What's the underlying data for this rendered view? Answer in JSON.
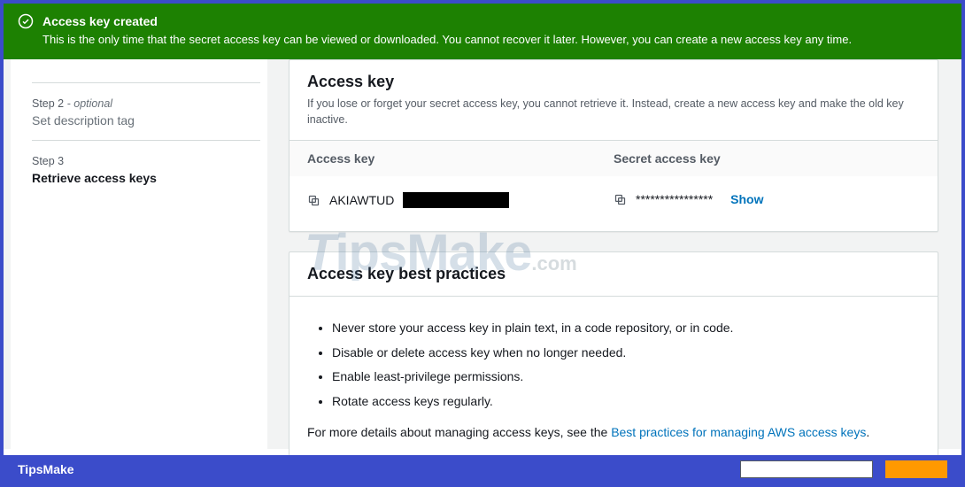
{
  "alert": {
    "title": "Access key created",
    "message": "This is the only time that the secret access key can be viewed or downloaded. You cannot recover it later. However, you can create a new access key any time."
  },
  "sidebar": {
    "steps": [
      {
        "label": "Step 2",
        "optional": "- optional",
        "name": "Set description tag",
        "active": false
      },
      {
        "label": "Step 3",
        "optional": "",
        "name": "Retrieve access keys",
        "active": true
      }
    ]
  },
  "access_key_panel": {
    "title": "Access key",
    "description": "If you lose or forget your secret access key, you cannot retrieve it. Instead, create a new access key and make the old key inactive.",
    "col1_header": "Access key",
    "col2_header": "Secret access key",
    "access_key_prefix": "AKIAWTUD",
    "secret_masked": "****************",
    "show_label": "Show"
  },
  "best_practices_panel": {
    "title": "Access key best practices",
    "bullets": [
      "Never store your access key in plain text, in a code repository, or in code.",
      "Disable or delete access key when no longer needed.",
      "Enable least-privilege permissions.",
      "Rotate access keys regularly."
    ],
    "more_prefix": "For more details about managing access keys, see the ",
    "more_link": "Best practices for managing AWS access keys",
    "more_suffix": "."
  },
  "footer": {
    "brand": "TipsMake"
  },
  "watermark": {
    "t": "T",
    "ips": "ips",
    "make": "Make",
    "com": ".com"
  }
}
